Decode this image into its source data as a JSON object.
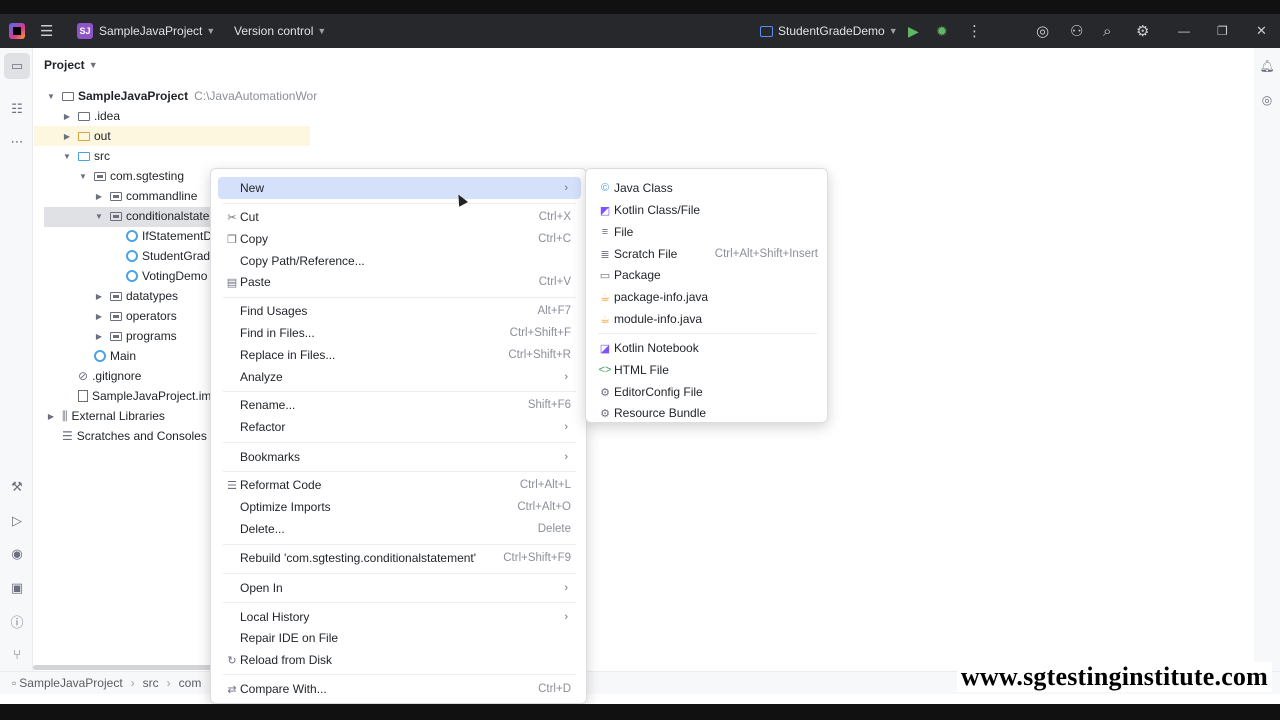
{
  "titlebar": {
    "project_badge": "SJ",
    "project_name": "SampleJavaProject",
    "vcs": "Version control",
    "run_config": "StudentGradeDemo"
  },
  "project_panel": {
    "title": "Project",
    "tree": [
      {
        "label": "SampleJavaProject",
        "hint": "C:\\JavaAutomationWor"
      },
      {
        "label": ".idea"
      },
      {
        "label": "out"
      },
      {
        "label": "src"
      },
      {
        "label": "com.sgtesting"
      },
      {
        "label": "commandline"
      },
      {
        "label": "conditionalstate"
      },
      {
        "label": "IfStatementDe"
      },
      {
        "label": "StudentGrade"
      },
      {
        "label": "VotingDemo"
      },
      {
        "label": "datatypes"
      },
      {
        "label": "operators"
      },
      {
        "label": "programs"
      },
      {
        "label": "Main"
      },
      {
        "label": ".gitignore"
      },
      {
        "label": "SampleJavaProject.iml"
      },
      {
        "label": "External Libraries"
      },
      {
        "label": "Scratches and Consoles"
      }
    ]
  },
  "context_menu": {
    "items": [
      {
        "label": "New",
        "shortcut": ""
      },
      {
        "label": "Cut",
        "shortcut": "Ctrl+X"
      },
      {
        "label": "Copy",
        "shortcut": "Ctrl+C"
      },
      {
        "label": "Copy Path/Reference...",
        "shortcut": ""
      },
      {
        "label": "Paste",
        "shortcut": "Ctrl+V"
      },
      {
        "label": "Find Usages",
        "shortcut": "Alt+F7"
      },
      {
        "label": "Find in Files...",
        "shortcut": "Ctrl+Shift+F"
      },
      {
        "label": "Replace in Files...",
        "shortcut": "Ctrl+Shift+R"
      },
      {
        "label": "Analyze",
        "shortcut": ""
      },
      {
        "label": "Rename...",
        "shortcut": "Shift+F6"
      },
      {
        "label": "Refactor",
        "shortcut": ""
      },
      {
        "label": "Bookmarks",
        "shortcut": ""
      },
      {
        "label": "Reformat Code",
        "shortcut": "Ctrl+Alt+L"
      },
      {
        "label": "Optimize Imports",
        "shortcut": "Ctrl+Alt+O"
      },
      {
        "label": "Delete...",
        "shortcut": "Delete"
      },
      {
        "label": "Rebuild 'com.sgtesting.conditionalstatement'",
        "shortcut": "Ctrl+Shift+F9"
      },
      {
        "label": "Open In",
        "shortcut": ""
      },
      {
        "label": "Local History",
        "shortcut": ""
      },
      {
        "label": "Repair IDE on File",
        "shortcut": ""
      },
      {
        "label": "Reload from Disk",
        "shortcut": ""
      },
      {
        "label": "Compare With...",
        "shortcut": "Ctrl+D"
      }
    ]
  },
  "new_submenu": {
    "items": [
      {
        "label": "Java Class",
        "shortcut": ""
      },
      {
        "label": "Kotlin Class/File",
        "shortcut": ""
      },
      {
        "label": "File",
        "shortcut": ""
      },
      {
        "label": "Scratch File",
        "shortcut": "Ctrl+Alt+Shift+Insert"
      },
      {
        "label": "Package",
        "shortcut": ""
      },
      {
        "label": "package-info.java",
        "shortcut": ""
      },
      {
        "label": "module-info.java",
        "shortcut": ""
      },
      {
        "label": "Kotlin Notebook",
        "shortcut": ""
      },
      {
        "label": "HTML File",
        "shortcut": ""
      },
      {
        "label": "EditorConfig File",
        "shortcut": ""
      },
      {
        "label": "Resource Bundle",
        "shortcut": ""
      }
    ]
  },
  "statusbar": {
    "crumb_1": "SampleJavaProject",
    "crumb_2": "src",
    "crumb_3": "com"
  },
  "watermark": "www.sgtestinginstitute.com"
}
